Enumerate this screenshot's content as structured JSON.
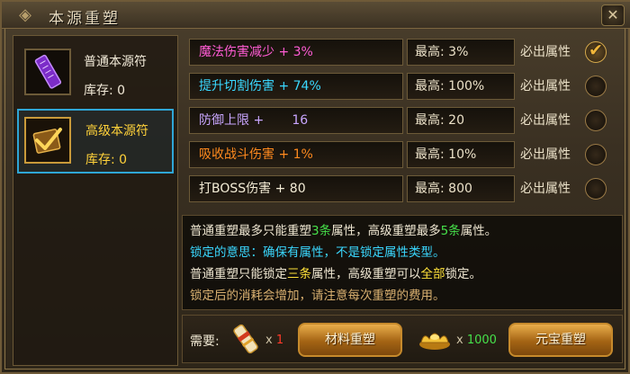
{
  "window": {
    "title": "本源重塑",
    "close_glyph": "✕"
  },
  "items": [
    {
      "name": "普通本源符",
      "stock_label": "库存:",
      "stock_value": "0",
      "icon": "purple-talisman-icon",
      "selected": false
    },
    {
      "name": "高级本源符",
      "stock_label": "库存:",
      "stock_value": "0",
      "icon": "gold-talisman-icon",
      "selected": true
    }
  ],
  "attributes": [
    {
      "name": "魔法伤害减少",
      "op": "+",
      "value": "3%",
      "max_label": "最高:",
      "max": "3%",
      "tag": "必出属性",
      "locked": true,
      "color": "#ff5cd4"
    },
    {
      "name": "提升切割伤害",
      "op": "+",
      "value": "74%",
      "max_label": "最高:",
      "max": "100%",
      "tag": "必出属性",
      "locked": false,
      "color": "#3ad8ff"
    },
    {
      "name": "防御上限",
      "op": "+",
      "value": "16",
      "max_label": "最高:",
      "max": "20",
      "tag": "必出属性",
      "locked": false,
      "color": "#c9a6ff"
    },
    {
      "name": "吸收战斗伤害",
      "op": "+",
      "value": "1%",
      "max_label": "最高:",
      "max": "10%",
      "tag": "必出属性",
      "locked": false,
      "color": "#ff8a1e"
    },
    {
      "name": "打BOSS伤害",
      "op": "+",
      "value": "80",
      "max_label": "最高:",
      "max": "800",
      "tag": "必出属性",
      "locked": false,
      "color": "#f3ecd6"
    }
  ],
  "info": {
    "line1": {
      "a": "普通重塑最多只能重塑",
      "b": "3条",
      "c": "属性，高级重塑最多",
      "d": "5条",
      "e": "属性。"
    },
    "line2": {
      "a": "锁定的意思：确保有属性，不是锁定属性类型。"
    },
    "line3": {
      "a": "普通重塑只能锁定",
      "b": "三条",
      "c": "属性，高级重塑可以",
      "d": "全部",
      "e": "锁定。"
    },
    "line4": {
      "a": "锁定后的消耗会增加，请注意每次重塑的费用。"
    }
  },
  "cost": {
    "need_label": "需要:",
    "material_qty_prefix": "x",
    "material_qty": "1",
    "material_button": "材料重塑",
    "ingot_qty_prefix": "x",
    "ingot_qty": "1000",
    "yuanbao_button": "元宝重塑"
  }
}
